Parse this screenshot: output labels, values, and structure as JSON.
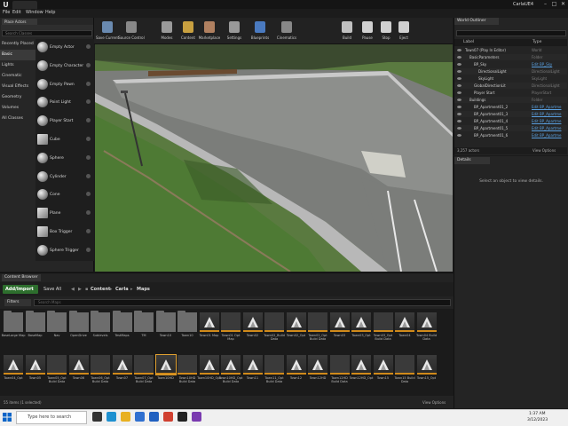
{
  "window": {
    "project_name": "CarlaUE4",
    "menu": [
      "File",
      "Edit",
      "Window",
      "Help"
    ]
  },
  "modes_panel": {
    "tab_label": "Place Actors",
    "search_placeholder": "Search Classes",
    "categories": [
      "Recently Placed",
      "Basic",
      "Lights",
      "Cinematic",
      "Visual Effects",
      "Geometry",
      "Volumes",
      "All Classes"
    ],
    "selected_category": "Basic",
    "items": [
      {
        "label": "Empty Actor",
        "icon": "sphere-icon"
      },
      {
        "label": "Empty Character",
        "icon": "sphere-icon"
      },
      {
        "label": "Empty Pawn",
        "icon": "sphere-icon"
      },
      {
        "label": "Point Light",
        "icon": "light-bulb-icon"
      },
      {
        "label": "Player Start",
        "icon": "player-start-icon"
      },
      {
        "label": "Cube",
        "icon": "cube-icon"
      },
      {
        "label": "Sphere",
        "icon": "sphere-icon"
      },
      {
        "label": "Cylinder",
        "icon": "cylinder-icon"
      },
      {
        "label": "Cone",
        "icon": "cone-icon"
      },
      {
        "label": "Plane",
        "icon": "plane-icon"
      },
      {
        "label": "Box Trigger",
        "icon": "box-trigger-icon"
      },
      {
        "label": "Sphere Trigger",
        "icon": "sphere-trigger-icon"
      }
    ]
  },
  "toolbar": {
    "buttons": [
      {
        "label": "Save Current",
        "icon": "save-icon"
      },
      {
        "label": "Source Control",
        "icon": "source-control-icon"
      },
      {
        "label": "Modes",
        "icon": "modes-icon"
      },
      {
        "label": "Content",
        "icon": "content-icon"
      },
      {
        "label": "Marketplace",
        "icon": "marketplace-icon"
      },
      {
        "label": "Settings",
        "icon": "gear-icon"
      },
      {
        "label": "Blueprints",
        "icon": "blueprints-icon"
      },
      {
        "label": "Cinematics",
        "icon": "cinematics-icon"
      },
      {
        "label": "Build",
        "icon": "build-icon"
      },
      {
        "label": "Pause",
        "icon": "pause-icon"
      },
      {
        "label": "Stop",
        "icon": "stop-icon"
      },
      {
        "label": "Eject",
        "icon": "eject-icon"
      }
    ]
  },
  "outliner": {
    "tab_label": "World Outliner",
    "col_label": "Label",
    "col_type": "Type",
    "rows": [
      {
        "label": "Town07 (Play In Editor)",
        "type": "World",
        "indent": 0,
        "link": false
      },
      {
        "label": "BasicParameters",
        "type": "Folder",
        "indent": 1,
        "link": false
      },
      {
        "label": "BP_Sky",
        "type": "Edit BP_Sky",
        "indent": 2,
        "link": true
      },
      {
        "label": "DirectionalLight",
        "type": "DirectionalLight",
        "indent": 3,
        "link": false
      },
      {
        "label": "SkyLight",
        "type": "SkyLight",
        "indent": 3,
        "link": false
      },
      {
        "label": "GlobalDirectionLit",
        "type": "DirectionalLight",
        "indent": 2,
        "link": false
      },
      {
        "label": "Player Start",
        "type": "PlayerStart",
        "indent": 2,
        "link": false
      },
      {
        "label": "Buildings",
        "type": "Folder",
        "indent": 1,
        "link": false
      },
      {
        "label": "BP_Apartment01_2",
        "type": "Edit BP_Apartme",
        "indent": 2,
        "link": true
      },
      {
        "label": "BP_Apartment01_3",
        "type": "Edit BP_Apartme",
        "indent": 2,
        "link": true
      },
      {
        "label": "BP_Apartment01_4",
        "type": "Edit BP_Apartme",
        "indent": 2,
        "link": true
      },
      {
        "label": "BP_Apartment01_5",
        "type": "Edit BP_Apartme",
        "indent": 2,
        "link": true
      },
      {
        "label": "BP_Apartment01_6",
        "type": "Edit BP_Apartme",
        "indent": 2,
        "link": true
      }
    ],
    "actor_count": "3,257 actors",
    "view_options": "View Options"
  },
  "details": {
    "tab_label": "Details",
    "message": "Select an object to view details."
  },
  "content_browser": {
    "tab_label": "Content Browser",
    "add_import": "Add/Import",
    "save_all": "Save All",
    "breadcrumb": [
      "Content",
      "Carla",
      "Maps"
    ],
    "filters": "Filters",
    "search_placeholder": "Search Maps",
    "assets": [
      {
        "label": "BaseLarge Map",
        "kind": "folder"
      },
      {
        "label": "BaseMap",
        "kind": "folder"
      },
      {
        "label": "Nav",
        "kind": "folder"
      },
      {
        "label": "OpenDrive",
        "kind": "folder"
      },
      {
        "label": "Sublevels",
        "kind": "folder"
      },
      {
        "label": "TestMaps",
        "kind": "folder"
      },
      {
        "label": "TM",
        "kind": "folder"
      },
      {
        "label": "Town10",
        "kind": "folder"
      },
      {
        "label": "Town10",
        "kind": "folder"
      },
      {
        "label": "Town01 Map",
        "kind": "map"
      },
      {
        "label": "Town01 Opt Map",
        "kind": "blank"
      },
      {
        "label": "Town02",
        "kind": "map"
      },
      {
        "label": "Town02_Build Data",
        "kind": "blank"
      },
      {
        "label": "Town02_Opt",
        "kind": "map"
      },
      {
        "label": "Town02_Opt Build Data",
        "kind": "blank"
      },
      {
        "label": "Town03",
        "kind": "map"
      },
      {
        "label": "Town03_Opt",
        "kind": "map"
      },
      {
        "label": "Town03_Opt Build Data",
        "kind": "blank"
      },
      {
        "label": "Town04",
        "kind": "map"
      },
      {
        "label": "Town04 Build Data",
        "kind": "map"
      },
      {
        "label": "Town04_Opt",
        "kind": "map"
      },
      {
        "label": "Town05",
        "kind": "map"
      },
      {
        "label": "Town05_Opt Build Data",
        "kind": "blank"
      },
      {
        "label": "Town06",
        "kind": "map"
      },
      {
        "label": "Town06_Opt Build Data",
        "kind": "blank"
      },
      {
        "label": "Town07",
        "kind": "map"
      },
      {
        "label": "Town07_Opt Build Data",
        "kind": "blank"
      },
      {
        "label": "Town10HD",
        "kind": "map",
        "selected": true
      },
      {
        "label": "Town10HD Build Data",
        "kind": "blank"
      },
      {
        "label": "Town10HD_Opt",
        "kind": "map"
      },
      {
        "label": "Town10HD_Opt Build Data",
        "kind": "map"
      },
      {
        "label": "Town11",
        "kind": "map"
      },
      {
        "label": "Town11_Opt Build Data",
        "kind": "blank"
      },
      {
        "label": "Town12",
        "kind": "map"
      },
      {
        "label": "Town12HD",
        "kind": "map"
      },
      {
        "label": "Town12HD Build Data",
        "kind": "blank"
      },
      {
        "label": "Town12HD_Opt",
        "kind": "map"
      },
      {
        "label": "Town15",
        "kind": "map"
      },
      {
        "label": "Town15 Build Data",
        "kind": "blank"
      },
      {
        "label": "Town15_Opt",
        "kind": "map"
      }
    ],
    "status": "55 items (1 selected)",
    "view_options": "View Options"
  },
  "taskbar": {
    "search_placeholder": "Type here to search",
    "time": "1:37 AM",
    "date": "3/12/2023"
  }
}
